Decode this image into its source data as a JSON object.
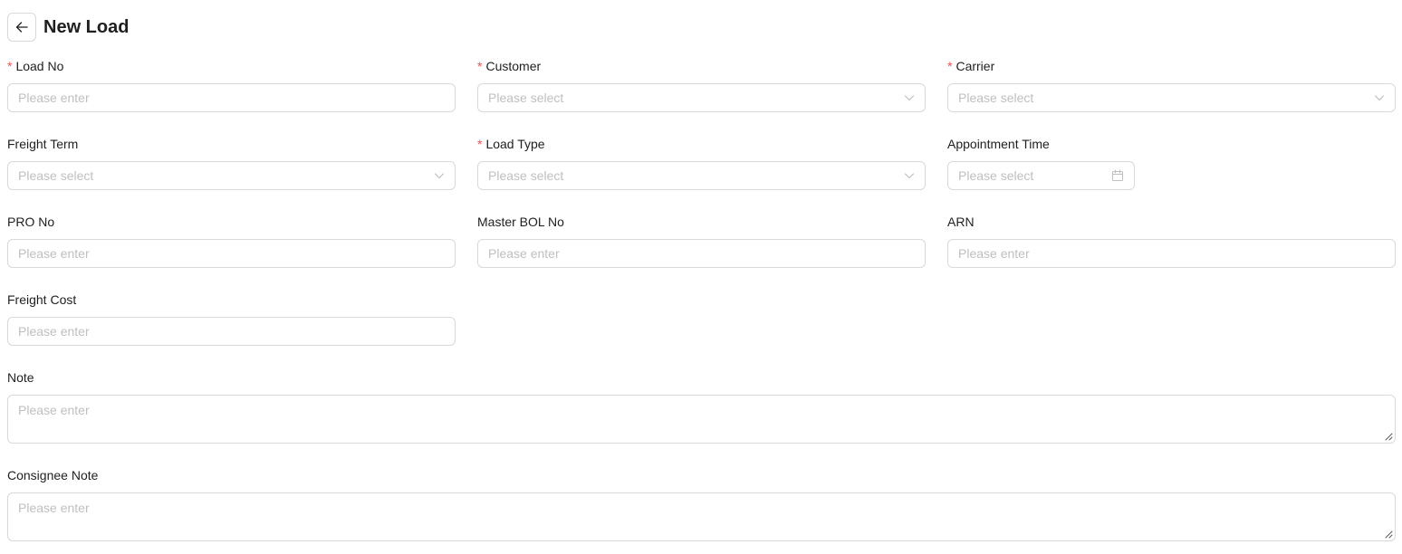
{
  "header": {
    "title": "New Load",
    "back_icon": "arrow-left-icon"
  },
  "form": {
    "load_no": {
      "label": "Load No",
      "required_mark": "*",
      "placeholder": "Please enter"
    },
    "customer": {
      "label": "Customer",
      "required_mark": "*",
      "placeholder": "Please select"
    },
    "carrier": {
      "label": "Carrier",
      "required_mark": "*",
      "placeholder": "Please select"
    },
    "freight_term": {
      "label": "Freight Term",
      "placeholder": "Please select"
    },
    "load_type": {
      "label": "Load Type",
      "required_mark": "*",
      "placeholder": "Please select"
    },
    "appointment_time": {
      "label": "Appointment Time",
      "placeholder": "Please select"
    },
    "pro_no": {
      "label": "PRO No",
      "placeholder": "Please enter"
    },
    "master_bol_no": {
      "label": "Master BOL No",
      "placeholder": "Please enter"
    },
    "arn": {
      "label": "ARN",
      "placeholder": "Please enter"
    },
    "freight_cost": {
      "label": "Freight Cost",
      "placeholder": "Please enter"
    },
    "note": {
      "label": "Note",
      "placeholder": "Please enter"
    },
    "consignee_note": {
      "label": "Consignee Note",
      "placeholder": "Please enter"
    }
  },
  "colors": {
    "required": "#ff4d4f",
    "border": "#d9d9d9",
    "placeholder": "#bfbfbf",
    "text": "#1f1f1f"
  }
}
